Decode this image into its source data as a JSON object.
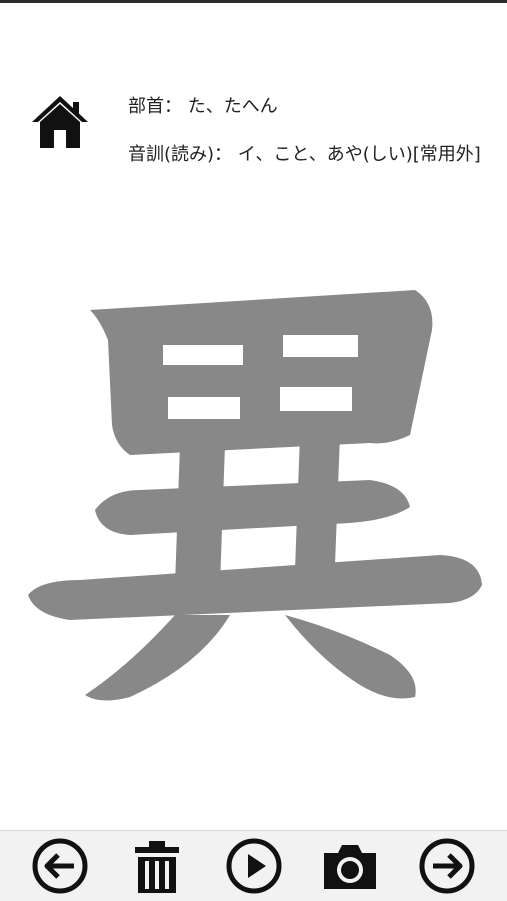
{
  "header": {
    "radical_label": "部首：",
    "radical_value": "た、たへん",
    "reading_label": "音訓(読み)：",
    "reading_value": "イ、こと、あや(しい)[常用外]"
  },
  "kanji": {
    "character": "異",
    "color": "#888888"
  },
  "icons": {
    "home": "home-icon",
    "back": "arrow-left-icon",
    "delete": "trash-icon",
    "play": "play-icon",
    "camera": "camera-icon",
    "next": "arrow-right-icon"
  },
  "colors": {
    "icon": "#111111",
    "toolbar_bg": "#f2f2f2"
  }
}
